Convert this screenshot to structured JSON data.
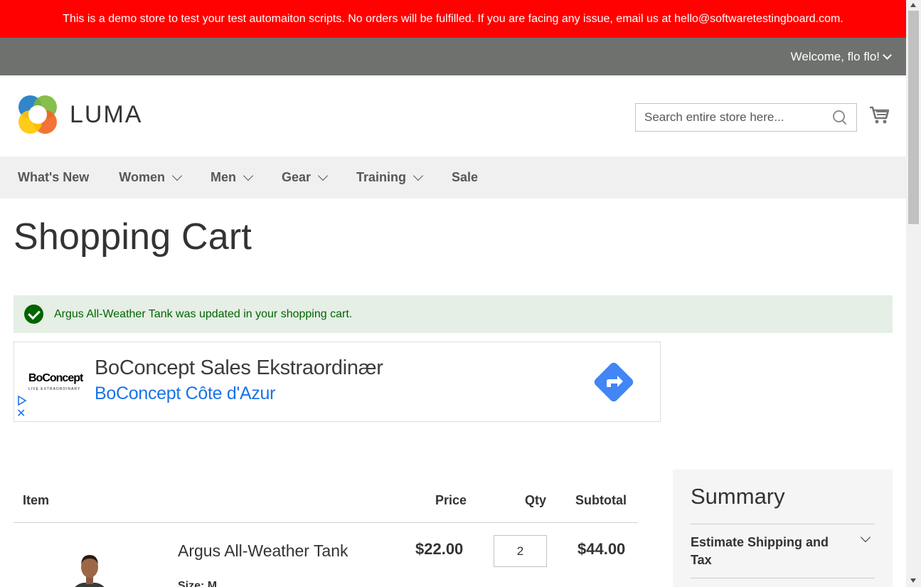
{
  "banner": {
    "text": "This is a demo store to test your test automaiton scripts. No orders will be fulfilled. If you are facing any issue, email us at hello@softwaretestingboard.com."
  },
  "panel": {
    "welcome": "Welcome, flo flo!"
  },
  "header": {
    "logo_text": "LUMA",
    "search_placeholder": "Search entire store here...",
    "cart_icon": "cart-icon"
  },
  "nav": {
    "items": [
      {
        "label": "What's New",
        "has_menu": false
      },
      {
        "label": "Women",
        "has_menu": true
      },
      {
        "label": "Men",
        "has_menu": true
      },
      {
        "label": "Gear",
        "has_menu": true
      },
      {
        "label": "Training",
        "has_menu": true
      },
      {
        "label": "Sale",
        "has_menu": false
      }
    ]
  },
  "page": {
    "title": "Shopping Cart",
    "message": "Argus All-Weather Tank was updated in your shopping cart."
  },
  "ad": {
    "brand": "BoConcept",
    "brand_tagline": "LIVE EXTRAORDINARY",
    "title": "BoConcept Sales Ekstraordinær",
    "subtitle": "BoConcept Côte d'Azur",
    "close": "✕"
  },
  "cart": {
    "headers": {
      "item": "Item",
      "price": "Price",
      "qty": "Qty",
      "subtotal": "Subtotal"
    },
    "items": [
      {
        "name": "Argus All-Weather Tank",
        "option": "Size: M",
        "price": "$22.00",
        "qty": "2",
        "subtotal": "$44.00"
      }
    ]
  },
  "summary": {
    "title": "Summary",
    "estimate": "Estimate Shipping and Tax"
  },
  "colors": {
    "banner": "#ff0101",
    "panel": "#6e716e",
    "nav_bg": "#f0f0f0",
    "success_bg": "#e5efe5",
    "success_text": "#006400",
    "ad_link": "#1a73e8",
    "ad_arrow": "#4285f4"
  }
}
